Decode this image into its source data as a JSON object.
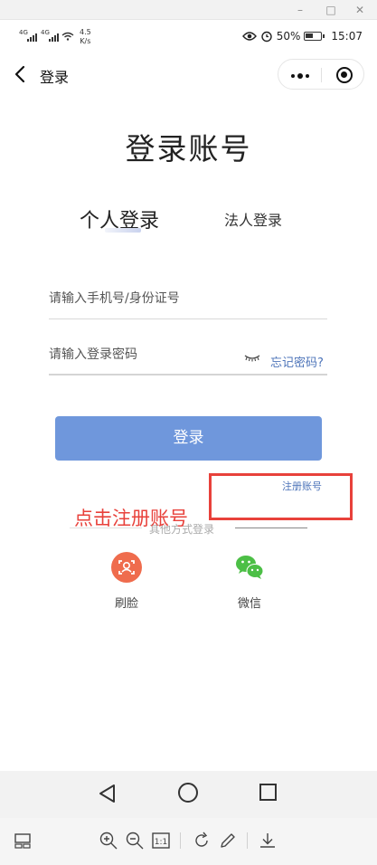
{
  "window": {
    "minimize": "–",
    "maximize": "□",
    "close": "✕"
  },
  "status": {
    "net1": "4G",
    "net2": "4G",
    "speed_value": "4.5",
    "speed_unit": "K/s",
    "battery": "50%",
    "time": "15:07"
  },
  "nav": {
    "title": "登录"
  },
  "page": {
    "title": "登录账号"
  },
  "tabs": {
    "personal": "个人登录",
    "corporate": "法人登录"
  },
  "form": {
    "phone_placeholder": "请输入手机号/身份证号",
    "password_placeholder": "请输入登录密码",
    "forgot": "忘记密码?",
    "login_button": "登录",
    "register": "注册账号"
  },
  "annotation": {
    "text": "点击注册账号",
    "color": "#e8413b"
  },
  "other_login": {
    "label": "其他方式登录",
    "face": "刷脸",
    "wechat": "微信"
  },
  "colors": {
    "accent": "#6f97dc",
    "link": "#4d74b9",
    "face_icon": "#ef6c4d",
    "wechat_icon": "#4cbf46"
  }
}
